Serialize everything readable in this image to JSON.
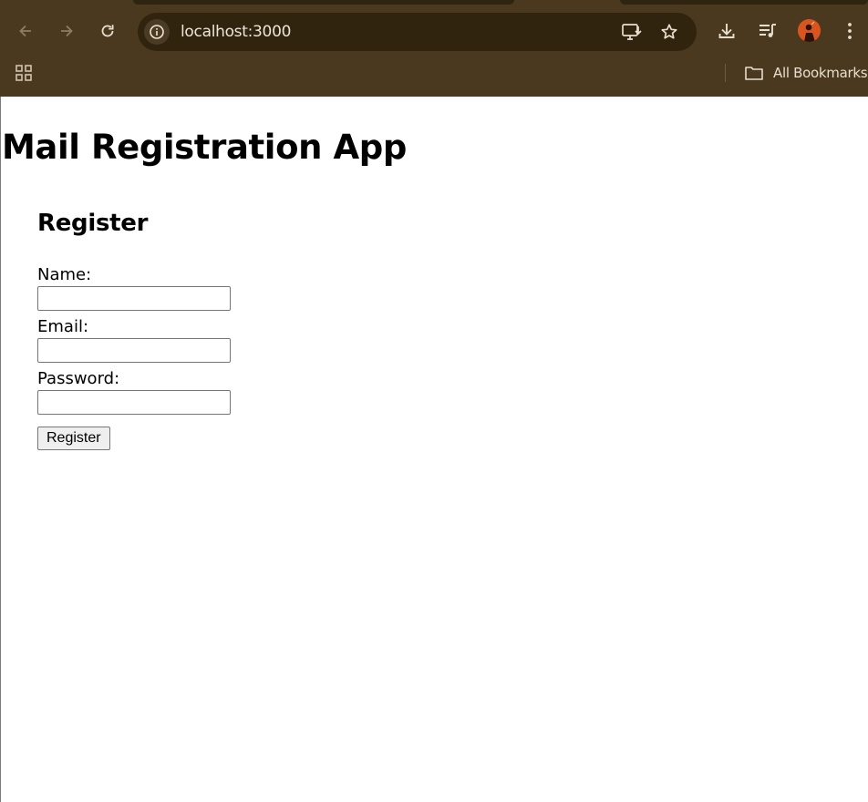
{
  "browser": {
    "url": "localhost:3000",
    "bookmarks_label": "All Bookmarks",
    "chrome_color": "#4a391e",
    "omnibox_color": "#30240f",
    "icons": {
      "back": "arrow-left-icon",
      "forward": "arrow-right-icon",
      "reload": "reload-icon",
      "site_info": "info-icon",
      "install": "install-app-icon",
      "bookmark": "star-icon",
      "downloads": "download-icon",
      "media": "media-queue-icon",
      "profile": "avatar",
      "menu": "kebab-menu-icon",
      "apps": "apps-grid-icon",
      "folder": "folder-icon"
    }
  },
  "page": {
    "title": "Mail Registration App",
    "form": {
      "heading": "Register",
      "name_label": "Name:",
      "name_value": "",
      "email_label": "Email:",
      "email_value": "",
      "password_label": "Password:",
      "password_value": "",
      "submit_label": "Register"
    }
  }
}
